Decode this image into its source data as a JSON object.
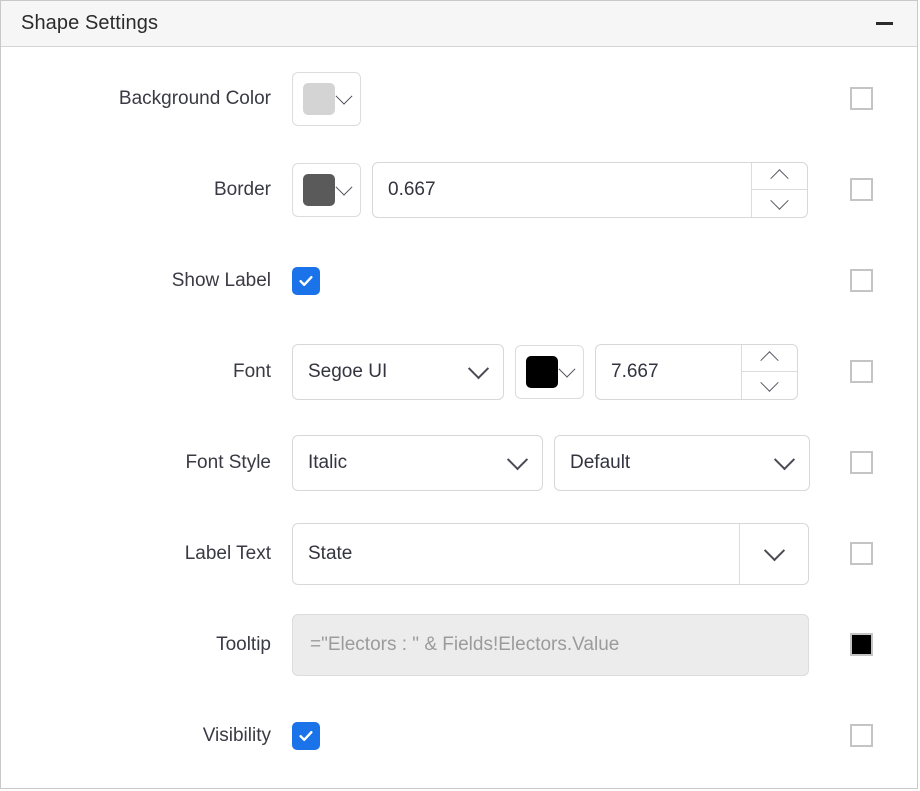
{
  "header": {
    "title": "Shape Settings",
    "collapse_icon": "minus-icon"
  },
  "rows": {
    "background_color": {
      "label": "Background Color",
      "swatch_color": "#d4d4d4",
      "expression_checked": false
    },
    "border": {
      "label": "Border",
      "swatch_color": "#5a5a5a",
      "width_value": "0.667",
      "expression_checked": false
    },
    "show_label": {
      "label": "Show Label",
      "checked": true,
      "expression_checked": false
    },
    "font": {
      "label": "Font",
      "family_value": "Segoe UI",
      "color_swatch": "#000000",
      "size_value": "7.667",
      "expression_checked": false
    },
    "font_style": {
      "label": "Font Style",
      "style_value": "Italic",
      "weight_value": "Default",
      "expression_checked": false
    },
    "label_text": {
      "label": "Label Text",
      "value": "State",
      "expression_checked": false
    },
    "tooltip": {
      "label": "Tooltip",
      "value": "=\"Electors : \" & Fields!Electors.Value",
      "expression_checked": true
    },
    "visibility": {
      "label": "Visibility",
      "checked": true,
      "expression_checked": false
    }
  }
}
